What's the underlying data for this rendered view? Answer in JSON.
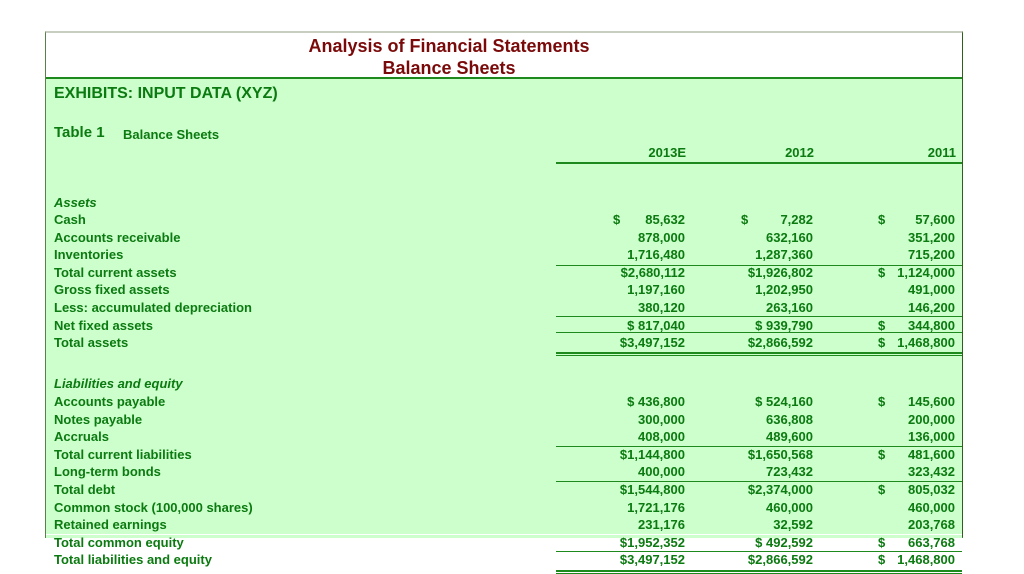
{
  "title": {
    "line1": "Analysis of Financial Statements",
    "line2": "Balance Sheets"
  },
  "exhibit_heading": "EXHIBITS: INPUT DATA (XYZ)",
  "table": {
    "label": "Table 1",
    "caption": "Balance Sheets",
    "columns": [
      "2013E",
      "2012",
      "2011"
    ],
    "assets_heading": "Assets",
    "assets": [
      {
        "label": "Cash",
        "values": [
          {
            "sign": "$",
            "v": "85,632"
          },
          {
            "sign": "$",
            "v": "7,282"
          },
          {
            "sign": "$",
            "v": "57,600"
          }
        ]
      },
      {
        "label": "Accounts receivable",
        "values": [
          {
            "sign": "",
            "v": "878,000"
          },
          {
            "sign": "",
            "v": "632,160"
          },
          {
            "sign": "",
            "v": "351,200"
          }
        ]
      },
      {
        "label": "Inventories",
        "values": [
          {
            "sign": "",
            "v": "1,716,480"
          },
          {
            "sign": "",
            "v": "1,287,360"
          },
          {
            "sign": "",
            "v": "715,200"
          }
        ]
      },
      {
        "label": "Total current assets",
        "values": [
          {
            "sign": "",
            "v": "$2,680,112"
          },
          {
            "sign": "",
            "v": "$1,926,802"
          },
          {
            "sign": "$",
            "v": "1,124,000"
          }
        ]
      },
      {
        "label": "Gross fixed assets",
        "values": [
          {
            "sign": "",
            "v": "1,197,160"
          },
          {
            "sign": "",
            "v": "1,202,950"
          },
          {
            "sign": "",
            "v": "491,000"
          }
        ]
      },
      {
        "label": "Less: accumulated depreciation",
        "values": [
          {
            "sign": "",
            "v": "380,120"
          },
          {
            "sign": "",
            "v": "263,160"
          },
          {
            "sign": "",
            "v": "146,200"
          }
        ]
      },
      {
        "label": "Net fixed assets",
        "values": [
          {
            "sign": "",
            "v": "$ 817,040"
          },
          {
            "sign": "",
            "v": "$ 939,790"
          },
          {
            "sign": "$",
            "v": "344,800"
          }
        ]
      },
      {
        "label": "Total assets",
        "values": [
          {
            "sign": "",
            "v": "$3,497,152"
          },
          {
            "sign": "",
            "v": "$2,866,592"
          },
          {
            "sign": "$",
            "v": "1,468,800"
          }
        ]
      }
    ],
    "liabilities_heading": "Liabilities and equity",
    "liabilities": [
      {
        "label": "Accounts payable",
        "values": [
          {
            "sign": "",
            "v": "$ 436,800"
          },
          {
            "sign": "",
            "v": "$ 524,160"
          },
          {
            "sign": "$",
            "v": "145,600"
          }
        ]
      },
      {
        "label": "Notes payable",
        "values": [
          {
            "sign": "",
            "v": "300,000"
          },
          {
            "sign": "",
            "v": "636,808"
          },
          {
            "sign": "",
            "v": "200,000"
          }
        ]
      },
      {
        "label": "Accruals",
        "values": [
          {
            "sign": "",
            "v": "408,000"
          },
          {
            "sign": "",
            "v": "489,600"
          },
          {
            "sign": "",
            "v": "136,000"
          }
        ]
      },
      {
        "label": "Total current liabilities",
        "values": [
          {
            "sign": "",
            "v": "$1,144,800"
          },
          {
            "sign": "",
            "v": "$1,650,568"
          },
          {
            "sign": "$",
            "v": "481,600"
          }
        ]
      },
      {
        "label": "Long-term bonds",
        "values": [
          {
            "sign": "",
            "v": "400,000"
          },
          {
            "sign": "",
            "v": "723,432"
          },
          {
            "sign": "",
            "v": "323,432"
          }
        ]
      },
      {
        "label": "Total debt",
        "values": [
          {
            "sign": "",
            "v": "$1,544,800"
          },
          {
            "sign": "",
            "v": "$2,374,000"
          },
          {
            "sign": "$",
            "v": "805,032"
          }
        ]
      },
      {
        "label": "Common stock (100,000 shares)",
        "values": [
          {
            "sign": "",
            "v": "1,721,176"
          },
          {
            "sign": "",
            "v": "460,000"
          },
          {
            "sign": "",
            "v": "460,000"
          }
        ]
      },
      {
        "label": "Retained earnings",
        "values": [
          {
            "sign": "",
            "v": "231,176"
          },
          {
            "sign": "",
            "v": "32,592"
          },
          {
            "sign": "",
            "v": "203,768"
          }
        ]
      },
      {
        "label": "Total common equity",
        "values": [
          {
            "sign": "",
            "v": "$1,952,352"
          },
          {
            "sign": "",
            "v": "$ 492,592"
          },
          {
            "sign": "$",
            "v": "663,768"
          }
        ]
      },
      {
        "label": "Total liabilities and equity",
        "values": [
          {
            "sign": "",
            "v": "$3,497,152"
          },
          {
            "sign": "",
            "v": "$2,866,592"
          },
          {
            "sign": "$",
            "v": "1,468,800"
          }
        ]
      }
    ]
  },
  "colors": {
    "title": "#7a0a0a",
    "text": "#0b7a10",
    "background": "#ccffcc",
    "rule": "#1e8a1e"
  }
}
